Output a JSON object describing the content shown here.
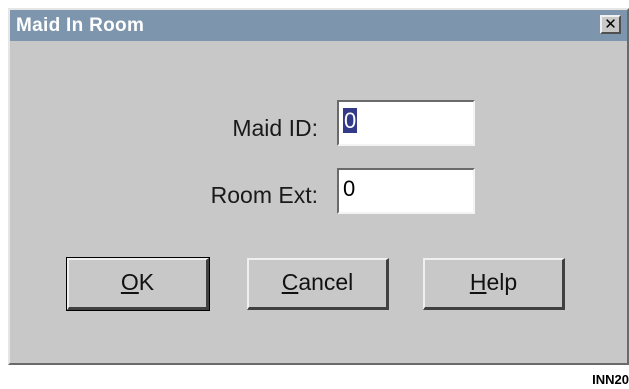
{
  "window": {
    "title": "Maid In Room",
    "close_glyph": "✕"
  },
  "fields": {
    "maid_id": {
      "label": "Maid ID:",
      "value": "0"
    },
    "room_ext": {
      "label": "Room Ext:",
      "value": "0"
    }
  },
  "buttons": {
    "ok": {
      "mnemonic": "O",
      "rest": "K"
    },
    "cancel": {
      "mnemonic": "C",
      "rest": "ancel"
    },
    "help": {
      "mnemonic": "H",
      "rest": "elp"
    }
  },
  "figure_tag": "INN20"
}
